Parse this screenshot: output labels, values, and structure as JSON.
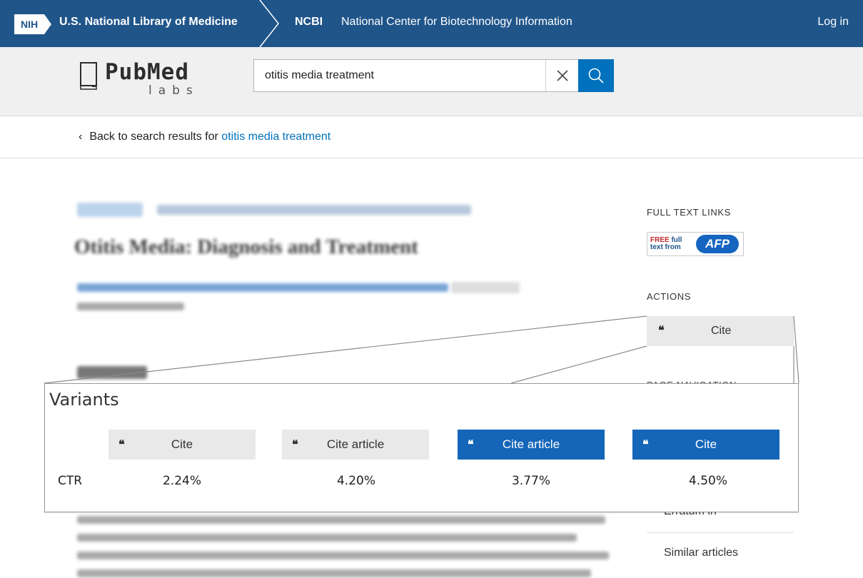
{
  "topbar": {
    "nih_badge": "NIH",
    "nlm": "U.S. National Library of Medicine",
    "ncbi": "NCBI",
    "ncbi_full": "National Center for Biotechnology Information",
    "login": "Log in"
  },
  "logo": {
    "word": "PubMed",
    "sub": "labs"
  },
  "search": {
    "query": "otitis media treatment"
  },
  "back": {
    "prefix": "Back to search results for ",
    "link": "otitis media treatment"
  },
  "article": {
    "title": "Otitis Media: Diagnosis and Treatment"
  },
  "sidebar": {
    "full_text_links": "FULL TEXT LINKS",
    "afp_free": "FREE",
    "afp_full": "full",
    "afp_text_from": "text from",
    "afp_logo": "AFP",
    "actions": "ACTIONS",
    "cite": "Cite",
    "page_nav": "PAGE NAVIGATION",
    "erratum": "Erratum in",
    "similar": "Similar articles"
  },
  "variants": {
    "title": "Variants",
    "ctr_label": "CTR",
    "items": [
      {
        "label": "Cite",
        "style": "gray",
        "ctr": "2.24%"
      },
      {
        "label": "Cite article",
        "style": "gray",
        "ctr": "4.20%"
      },
      {
        "label": "Cite article",
        "style": "blue",
        "ctr": "3.77%"
      },
      {
        "label": "Cite",
        "style": "blue",
        "ctr": "4.50%"
      }
    ]
  },
  "colors": {
    "ncbi_blue": "#20558a",
    "link_blue": "#0071bc",
    "variant_blue": "#1565b8",
    "variant_gray": "#e9e9e9"
  }
}
